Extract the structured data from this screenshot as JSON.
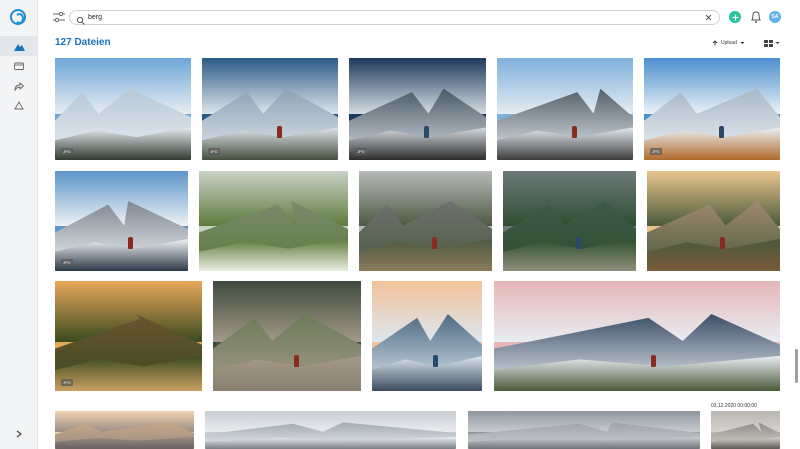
{
  "search": {
    "value": "berg",
    "placeholder": ""
  },
  "header": {
    "title": "127 Dateien",
    "upload_label": "Upload"
  },
  "user": {
    "initials": "SA"
  },
  "colors": {
    "accent": "#1a73b8",
    "add": "#25c39a",
    "avatar": "#5db3e8"
  },
  "sidebar": {
    "items": [
      {
        "icon": "mountain-icon",
        "active": true
      },
      {
        "icon": "folder-icon",
        "active": false
      },
      {
        "icon": "share-icon",
        "active": false
      },
      {
        "icon": "recycle-icon",
        "active": false
      }
    ]
  },
  "photos": [
    {
      "badge": "JPG",
      "scene": "snow-forest"
    },
    {
      "badge": "JPG",
      "scene": "snow-hiker"
    },
    {
      "badge": "JPG",
      "scene": "headlamp-night"
    },
    {
      "badge": "",
      "scene": "ridge-climbers"
    },
    {
      "badge": "JPG",
      "scene": "ice-axe-climber"
    },
    {
      "badge": "JPG",
      "scene": "snow-cliffs"
    },
    {
      "badge": "",
      "scene": "edelweiss"
    },
    {
      "badge": "",
      "scene": "hiker-valley"
    },
    {
      "badge": "",
      "scene": "green-ridge"
    },
    {
      "badge": "",
      "scene": "sunset-sitter"
    },
    {
      "badge": "JPG",
      "scene": "forest-sunburst"
    },
    {
      "badge": "",
      "scene": "rocky-hikers"
    },
    {
      "badge": "",
      "scene": "sea-of-clouds"
    },
    {
      "badge": "",
      "scene": "cloud-inversion"
    },
    {
      "badge": "",
      "scene": "dawn-peaks"
    },
    {
      "badge": "",
      "scene": "snow-panorama"
    },
    {
      "badge": "",
      "scene": "cloudy-peaks"
    },
    {
      "badge": "",
      "scene": "grey-ridge"
    }
  ],
  "group_date": "03.12.2020 00:00:00"
}
